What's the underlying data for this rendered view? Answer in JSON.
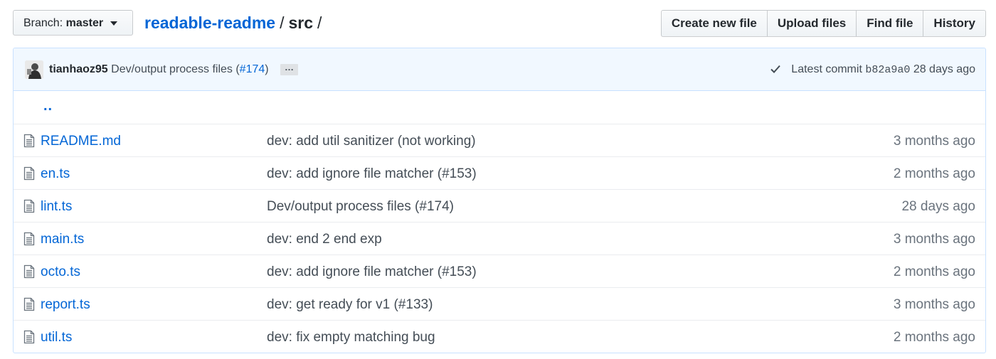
{
  "branch": {
    "label": "Branch:",
    "name": "master"
  },
  "breadcrumb": {
    "repo": "readable-readme",
    "folder": "src",
    "sep1": "/",
    "sep2": "/"
  },
  "actions": [
    "Create new file",
    "Upload files",
    "Find file",
    "History"
  ],
  "commit": {
    "author": "tianhaoz95",
    "message": "Dev/output process files (",
    "pr": "#174",
    "message_end": ")",
    "ellipsis": "…",
    "latest_label": "Latest commit",
    "sha": "b82a9a0",
    "age": "28 days ago"
  },
  "up_dir": "..",
  "files": [
    {
      "name": "README.md",
      "message": "dev: add util sanitizer (not working)",
      "age": "3 months ago"
    },
    {
      "name": "en.ts",
      "message": "dev: add ignore file matcher (#153)",
      "age": "2 months ago"
    },
    {
      "name": "lint.ts",
      "message": "Dev/output process files (#174)",
      "age": "28 days ago"
    },
    {
      "name": "main.ts",
      "message": "dev: end 2 end exp",
      "age": "3 months ago"
    },
    {
      "name": "octo.ts",
      "message": "dev: add ignore file matcher (#153)",
      "age": "2 months ago"
    },
    {
      "name": "report.ts",
      "message": "dev: get ready for v1 (#133)",
      "age": "3 months ago"
    },
    {
      "name": "util.ts",
      "message": "dev: fix empty matching bug",
      "age": "2 months ago"
    }
  ],
  "icons": {
    "file": "file-text-icon",
    "check": "check-icon",
    "caret": "caret-down-icon"
  },
  "colors": {
    "link": "#0366d6",
    "commit_bar_bg": "#f1f8ff",
    "border": "#c8e1ff"
  }
}
